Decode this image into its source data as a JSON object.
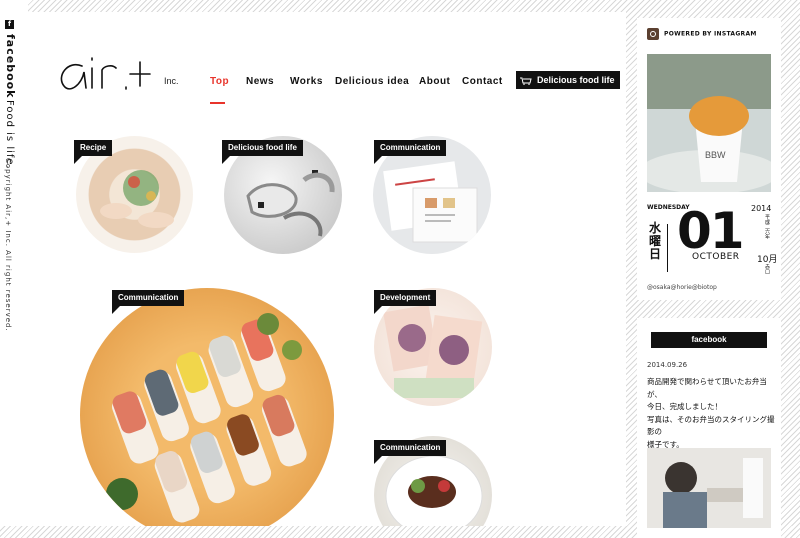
{
  "side": {
    "facebook": "facebook",
    "tagline": "Food is life.",
    "copyright": "Copyright Air,+ Inc. All right reserved."
  },
  "brand": {
    "logo_text": "air.+",
    "inc": "Inc."
  },
  "nav": {
    "items": [
      "Top",
      "News",
      "Works",
      "Delicious idea",
      "About",
      "Contact"
    ],
    "active": "Top",
    "cta": "Delicious food life"
  },
  "tiles": {
    "t1": "Recipe",
    "t2": "Delicious food life",
    "t3": "Communication",
    "t4": "Communication",
    "t5": "Development",
    "t6": "Communication"
  },
  "instagram": {
    "header": "POWERED BY INSTAGRAM",
    "weekday_en": "WEDNESDAY",
    "year": "2014",
    "weekday_jp": "水曜日",
    "day": "01",
    "month_en": "OCTOBER",
    "era": "平成二六年",
    "month_jp": "10月",
    "rokuyo": "赤口",
    "location": "@osaka@horie@biotop"
  },
  "facebook_card": {
    "header": "facebook",
    "date": "2014.09.26",
    "body": "商品開発で関わらせて頂いたお弁当が、\n今日、完成しました！\n写真は、そのお弁当のスタイリング撮影の\n様子です。\n販売が楽しみです！"
  },
  "colors": {
    "accent": "#e8342b",
    "ink": "#111111"
  }
}
